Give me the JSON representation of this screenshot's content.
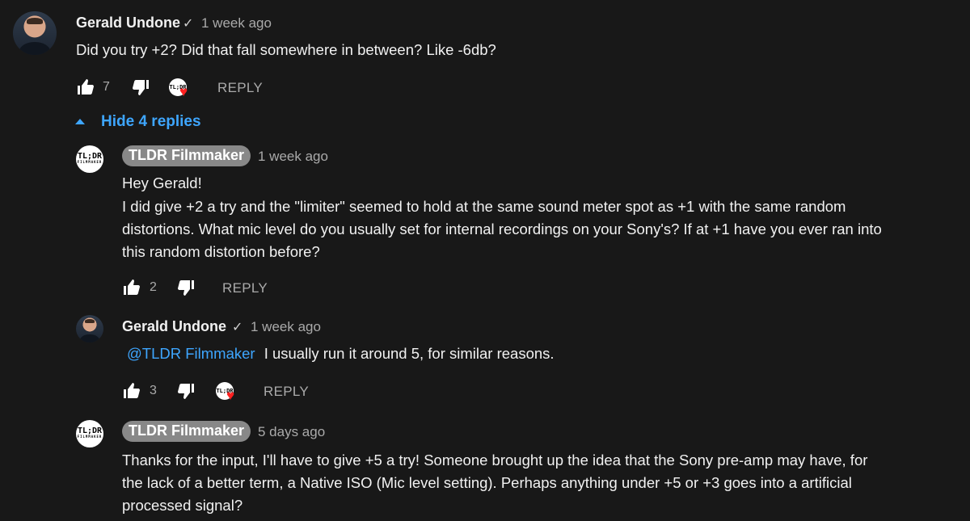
{
  "comment": {
    "author": "Gerald Undone",
    "time": "1 week ago",
    "text": "Did you try +2? Did that fall somewhere in between? Like -6db?",
    "likes": "7",
    "heart_mini": "TL;DR",
    "reply_label": "REPLY",
    "hide_replies": "Hide 4 replies"
  },
  "replies": [
    {
      "author": "TLDR Filmmaker",
      "time": "1 week ago",
      "lines": [
        "Hey Gerald!",
        "I did give +2 a try and the \"limiter\" seemed to hold at the same sound meter spot as +1 with the same random",
        "distortions. What mic level do you usually set for internal recordings on your Sony's? If at +1 have you ever ran into",
        "this random distortion before?"
      ],
      "likes": "2",
      "reply_label": "REPLY"
    },
    {
      "author": "Gerald Undone",
      "time": "1 week ago",
      "mention": "@TLDR Filmmaker",
      "text": "I usually run it around 5, for similar reasons.",
      "likes": "3",
      "heart_mini": "TL;DR",
      "reply_label": "REPLY"
    },
    {
      "author": "TLDR Filmmaker",
      "time": "5 days ago",
      "lines": [
        "Thanks for the input, I'll have to give +5 a try! Someone brought up the idea that the Sony pre-amp may have, for",
        "the lack of a better term, a Native ISO (Mic level setting). Perhaps anything under +5 or +3 goes into a artificial",
        "processed signal?"
      ]
    }
  ],
  "logo": {
    "big": "TL;DR",
    "small": "FILMMAKER"
  },
  "colors": {
    "background": "#181818",
    "link": "#3ea6ff",
    "secondary_text": "#aaaaaa",
    "heart": "#ff2020"
  },
  "icons": {
    "like": "thumb-up-icon",
    "dislike": "thumb-down-icon",
    "verified": "checkmark-icon",
    "collapse": "caret-up-icon",
    "hearted": "heart-icon"
  }
}
